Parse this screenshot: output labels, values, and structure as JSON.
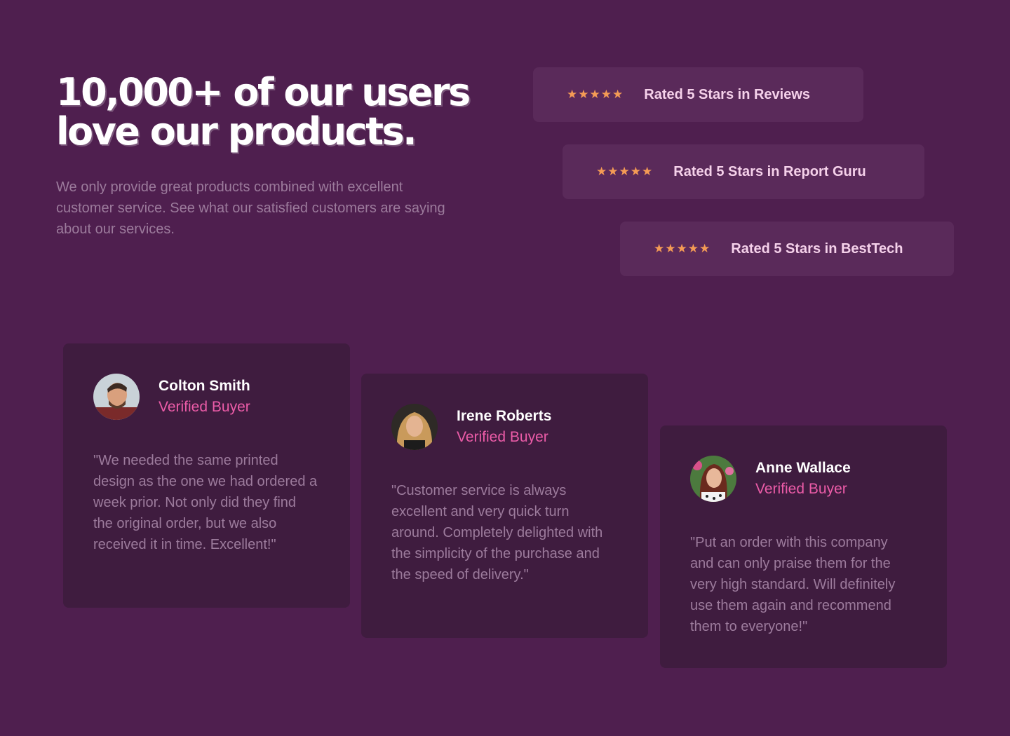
{
  "hero": {
    "title_line1": "10,000+ of our users",
    "title_line2": "love our products.",
    "description": "We only provide great products combined with excellent customer service. See what our satisfied customers are saying about our services."
  },
  "ratings": [
    {
      "stars": 5,
      "text": "Rated 5 Stars in Reviews"
    },
    {
      "stars": 5,
      "text": "Rated 5 Stars in Report Guru"
    },
    {
      "stars": 5,
      "text": "Rated 5 Stars in BestTech"
    }
  ],
  "testimonials": [
    {
      "name": "Colton Smith",
      "badge": "Verified Buyer",
      "quote": "\"We needed the same printed design as the one we had ordered a week prior. Not only did they find the original order, but we also received it in time. Excellent!\""
    },
    {
      "name": "Irene Roberts",
      "badge": "Verified Buyer",
      "quote": "\"Customer service is always excellent and very quick turn around. Completely delighted with the simplicity of the purchase and the speed of delivery.\""
    },
    {
      "name": "Anne Wallace",
      "badge": "Verified Buyer",
      "quote": "\"Put an order with this company and can only praise them for the very high standard. Will definitely use them again and recommend them to everyone!\""
    }
  ],
  "colors": {
    "background": "#4f1f4f",
    "rating_box": "#5a2a5a",
    "card": "#3f1c3f",
    "star": "#f49b55",
    "accent": "#ec5ca8",
    "muted_text": "#9c7b9c"
  },
  "icons": {
    "star": "star-icon",
    "avatar": "avatar-photo"
  }
}
